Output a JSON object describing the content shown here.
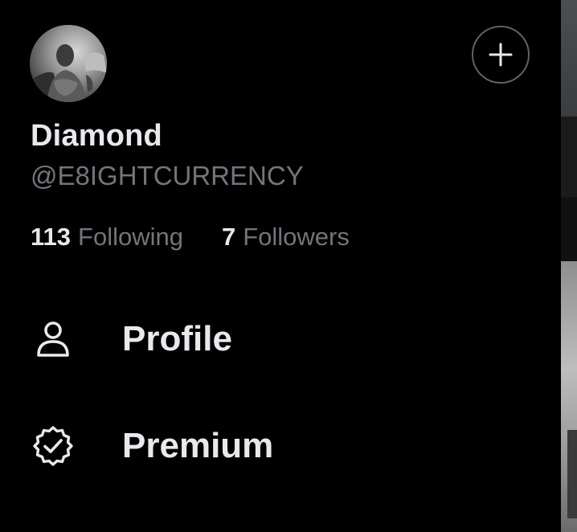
{
  "profile": {
    "avatar_icon": "avatar-photo",
    "display_name": "Diamond",
    "handle": "@E8IGHTCURRENCY",
    "following_count": "113",
    "following_label": "Following",
    "followers_count": "7",
    "followers_label": "Followers"
  },
  "header": {
    "add_icon": "plus-icon"
  },
  "menu": {
    "items": [
      {
        "label": "Profile",
        "icon": "person-icon"
      },
      {
        "label": "Premium",
        "icon": "verified-badge-icon"
      }
    ]
  },
  "colors": {
    "background": "#000000",
    "primary_text": "#e7e9ea",
    "secondary_text": "#71767b",
    "button_border": "#5b6369"
  }
}
